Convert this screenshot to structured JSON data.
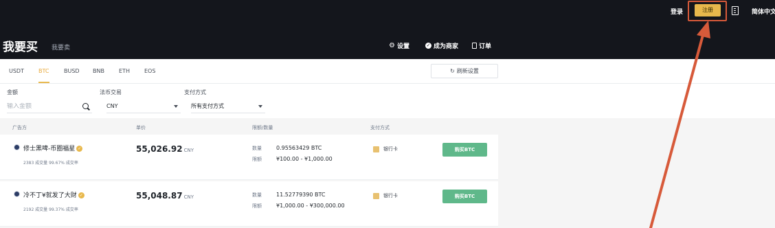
{
  "header": {
    "login": "登录",
    "register": "注册",
    "language": "简体中文",
    "title_buy": "我要买",
    "title_sell": "我要卖",
    "settings": "设置",
    "merchant": "成为商家",
    "orders": "订单"
  },
  "coins": {
    "tabs": [
      "USDT",
      "BTC",
      "BUSD",
      "BNB",
      "ETH",
      "EOS"
    ],
    "active": "BTC",
    "refresh": "刷新设置"
  },
  "filters": {
    "amount_label": "金额",
    "amount_placeholder": "输入金额",
    "fiat_label": "法币交易",
    "fiat_value": "CNY",
    "payment_label": "支付方式",
    "payment_value": "所有支付方式"
  },
  "table": {
    "headers": [
      "广告方",
      "单价",
      "限额/数量",
      "支付方式"
    ],
    "rows": [
      {
        "advertiser": "修士黑啤-币圈福星",
        "stats": "2383 成交量   99.67% 成交率",
        "price": "55,026.92",
        "currency": "CNY",
        "qty_label": "数量",
        "qty": "0.95563429 BTC",
        "limit_label": "限额",
        "limit": "¥100.00 - ¥1,000.00",
        "payment": "银行卡",
        "button": "购买BTC"
      },
      {
        "advertiser": "冷不丁¥就发了大财",
        "stats": "2192 成交量   99.37% 成交率",
        "price": "55,048.87",
        "currency": "CNY",
        "qty_label": "数量",
        "qty": "11.52779390 BTC",
        "limit_label": "限额",
        "limit": "¥1,000.00 - ¥300,000.00",
        "payment": "银行卡",
        "button": "购买BTC"
      }
    ]
  },
  "colors": {
    "header_bg": "#14161c",
    "accent": "#e8b84c",
    "buy_green": "#5fb88a",
    "annotation": "#d75a3a"
  }
}
